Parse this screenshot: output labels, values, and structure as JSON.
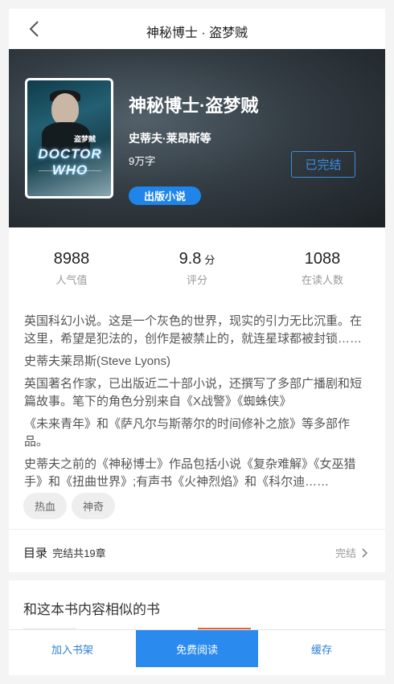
{
  "nav": {
    "title": "神秘博士 · 盗梦贼"
  },
  "book": {
    "title": "神秘博士·盗梦贼",
    "author": "史蒂夫·莱昂斯等",
    "words": "9万字",
    "status": "已完结",
    "tag": "出版小说",
    "cover": {
      "series_logo": "DOCTOR WHO",
      "subtitle": "盗梦贼"
    }
  },
  "stats": [
    {
      "value": "8988",
      "unit": "",
      "label": "人气值"
    },
    {
      "value": "9.8",
      "unit": "分",
      "label": "评分"
    },
    {
      "value": "1088",
      "unit": "",
      "label": "在读人数"
    }
  ],
  "description": [
    "英国科幻小说。这是一个灰色的世界，现实的引力无比沉重。在这里，希望是犯法的，创作是被禁止的，就连星球都被封锁……",
    "史蒂夫莱昂斯(Steve Lyons)",
    "英国著名作家，已出版近二十部小说，还撰写了多部广播剧和短篇故事。笔下的角色分别来自《X战警》《蜘蛛侠》",
    "《未来青年》和《萨凡尔与斯蒂尔的时间修补之旅》等多部作品。",
    "史蒂夫之前的《神秘博士》作品包括小说《复杂难解》《女巫猎手》和《扭曲世界》;有声书《火神烈焰》和《科尔迪……"
  ],
  "genres": [
    "热血",
    "神奇"
  ],
  "catalog": {
    "label": "目录",
    "count": "完结共19章",
    "status": "完结"
  },
  "similar": {
    "title": "和这本书内容相似的书"
  },
  "bottom": {
    "shelf": "加入书架",
    "read": "免费阅读",
    "cache": "缓存"
  },
  "colors": {
    "accent": "#2a8aee",
    "link": "#2d7fd6"
  }
}
